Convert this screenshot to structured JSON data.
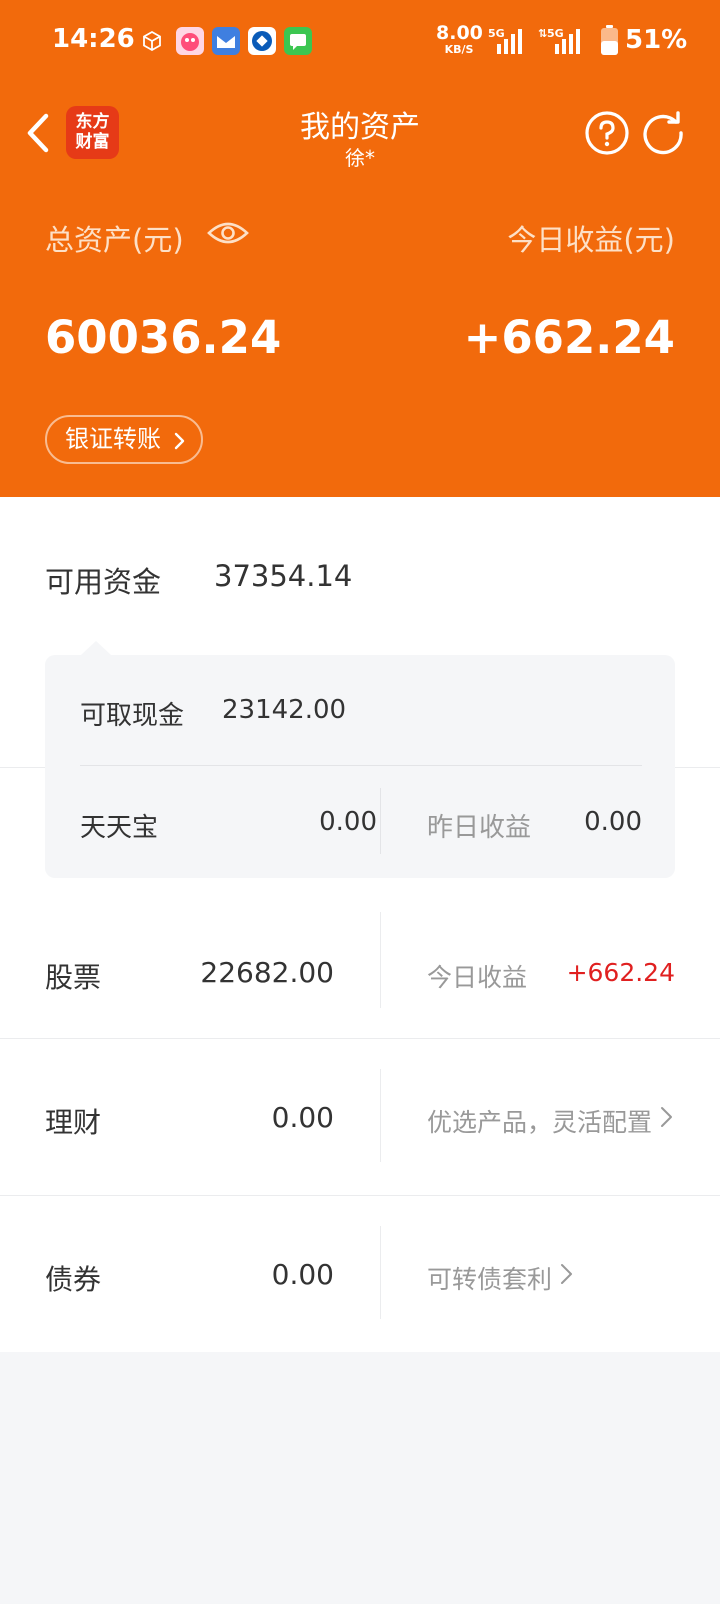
{
  "status_bar": {
    "time": "14:26",
    "net_speed": "8.00",
    "net_unit": "KB/S",
    "sig1": "5G",
    "sig2": "5G",
    "battery": "51%"
  },
  "nav": {
    "logo_line1": "东方",
    "logo_line2": "财富",
    "title": "我的资产",
    "subtitle": "徐*"
  },
  "summary": {
    "total_label": "总资产(元)",
    "total_value": "60036.24",
    "today_label": "今日收益(元)",
    "today_value": "+662.24",
    "transfer_label": "银证转账"
  },
  "available": {
    "label": "可用资金",
    "value": "37354.14"
  },
  "popover": {
    "cash_label": "可取现金",
    "cash_value": "23142.00",
    "tiantianbao_label": "天天宝",
    "tiantianbao_value": "0.00",
    "yesterday_label": "昨日收益",
    "yesterday_value": "0.00"
  },
  "stocks": {
    "label": "股票",
    "value": "22682.00",
    "today_label": "今日收益",
    "today_value": "+662.24"
  },
  "wealth": {
    "label": "理财",
    "value": "0.00",
    "link": "优选产品，灵活配置"
  },
  "bonds": {
    "label": "债券",
    "value": "0.00",
    "link": "可转债套利"
  },
  "colors": {
    "brand": "#f26a0c",
    "gain": "#e02020"
  }
}
